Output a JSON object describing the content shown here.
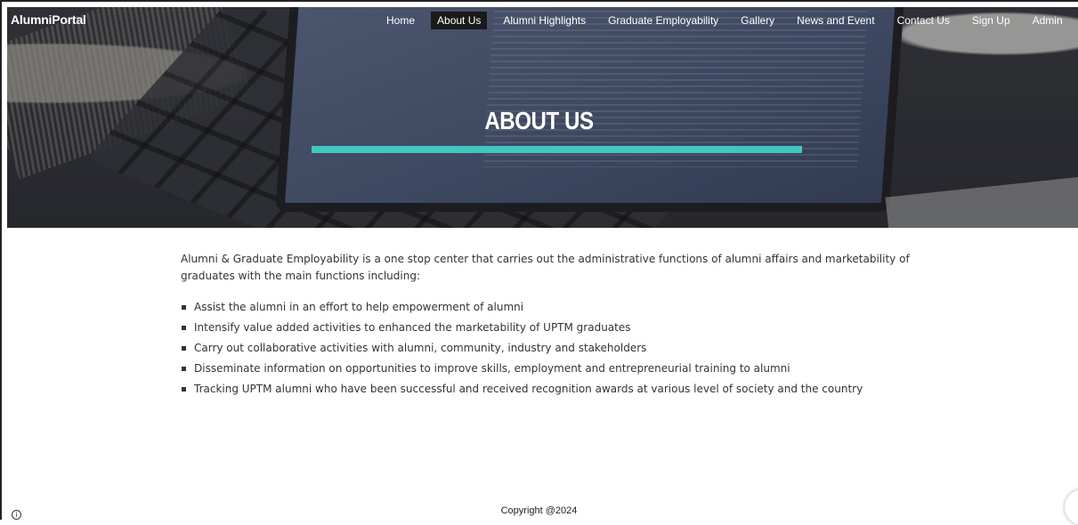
{
  "brand": "AlumniPortal",
  "nav": {
    "items": [
      {
        "label": "Home",
        "active": false
      },
      {
        "label": "About Us",
        "active": true
      },
      {
        "label": "Alumni Highlights",
        "active": false
      },
      {
        "label": "Graduate Employability",
        "active": false
      },
      {
        "label": "Gallery",
        "active": false
      },
      {
        "label": "News and Event",
        "active": false
      },
      {
        "label": "Contact Us",
        "active": false
      },
      {
        "label": "Sign Up",
        "active": false
      },
      {
        "label": "Admin",
        "active": false
      }
    ]
  },
  "hero": {
    "title": "ABOUT US",
    "accent_color": "#40c8c0"
  },
  "content": {
    "intro": "Alumni & Graduate Employability is a one stop center that carries out the administrative functions of alumni affairs and marketability of graduates with the main functions including:",
    "functions": [
      "Assist the alumni in an effort to help empowerment of alumni",
      "Intensify value added activities to enhanced the marketability of UPTM graduates",
      "Carry out collaborative activities with alumni, community, industry and stakeholders",
      "Disseminate information on opportunities to improve skills, employment and entrepreneurial training to alumni",
      "Tracking UPTM alumni who have been successful and received recognition awards at various level of society and the country"
    ]
  },
  "footer": {
    "copyright": "Copyright @2024"
  },
  "icons": {
    "info": "info-icon",
    "chat": "chat-icon"
  }
}
